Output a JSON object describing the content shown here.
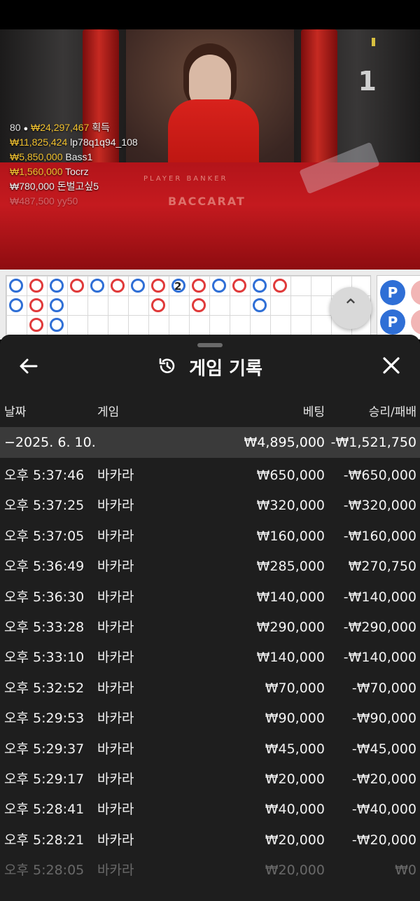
{
  "stream": {
    "round_number": "1",
    "table_text_1": "PLAYER          BANKER",
    "table_text_2": "BACCARAT",
    "winners_header": {
      "count": "80",
      "total": "₩24,297,467",
      "label": "획득"
    },
    "winners": [
      {
        "amount": "₩11,825,424",
        "name": "lp78q1q94_108"
      },
      {
        "amount": "₩5,850,000",
        "name": "Bass1"
      },
      {
        "amount": "₩1,560,000",
        "name": "Tocrz"
      },
      {
        "amount": "₩780,000",
        "name": "돈벌고싶5"
      },
      {
        "amount": "₩487,500",
        "name": "yy50"
      }
    ]
  },
  "roadmap": {
    "player_button": "P",
    "scroll_icon": "double-chevron-up-icon",
    "bead_marker": "2"
  },
  "history": {
    "title": "게임 기록",
    "back_icon": "arrow-left-icon",
    "close_icon": "close-icon",
    "title_icon": "history-icon",
    "columns": {
      "date": "날짜",
      "game": "게임",
      "bet": "베팅",
      "result": "승리/패배"
    },
    "summary": {
      "date": "−2025. 6. 10.",
      "bet": "₩4,895,000",
      "result": "-₩1,521,750"
    },
    "rows": [
      {
        "time": "오후 5:37:46",
        "game": "바카라",
        "bet": "₩650,000",
        "result": "-₩650,000"
      },
      {
        "time": "오후 5:37:25",
        "game": "바카라",
        "bet": "₩320,000",
        "result": "-₩320,000"
      },
      {
        "time": "오후 5:37:05",
        "game": "바카라",
        "bet": "₩160,000",
        "result": "-₩160,000"
      },
      {
        "time": "오후 5:36:49",
        "game": "바카라",
        "bet": "₩285,000",
        "result": "₩270,750"
      },
      {
        "time": "오후 5:36:30",
        "game": "바카라",
        "bet": "₩140,000",
        "result": "-₩140,000"
      },
      {
        "time": "오후 5:33:28",
        "game": "바카라",
        "bet": "₩290,000",
        "result": "-₩290,000"
      },
      {
        "time": "오후 5:33:10",
        "game": "바카라",
        "bet": "₩140,000",
        "result": "-₩140,000"
      },
      {
        "time": "오후 5:32:52",
        "game": "바카라",
        "bet": "₩70,000",
        "result": "-₩70,000"
      },
      {
        "time": "오후 5:29:53",
        "game": "바카라",
        "bet": "₩90,000",
        "result": "-₩90,000"
      },
      {
        "time": "오후 5:29:37",
        "game": "바카라",
        "bet": "₩45,000",
        "result": "-₩45,000"
      },
      {
        "time": "오후 5:29:17",
        "game": "바카라",
        "bet": "₩20,000",
        "result": "-₩20,000"
      },
      {
        "time": "오후 5:28:41",
        "game": "바카라",
        "bet": "₩40,000",
        "result": "-₩40,000"
      },
      {
        "time": "오후 5:28:21",
        "game": "바카라",
        "bet": "₩20,000",
        "result": "-₩20,000"
      },
      {
        "time": "오후 5:28:05",
        "game": "바카라",
        "bet": "₩20,000",
        "result": "₩0"
      }
    ]
  }
}
